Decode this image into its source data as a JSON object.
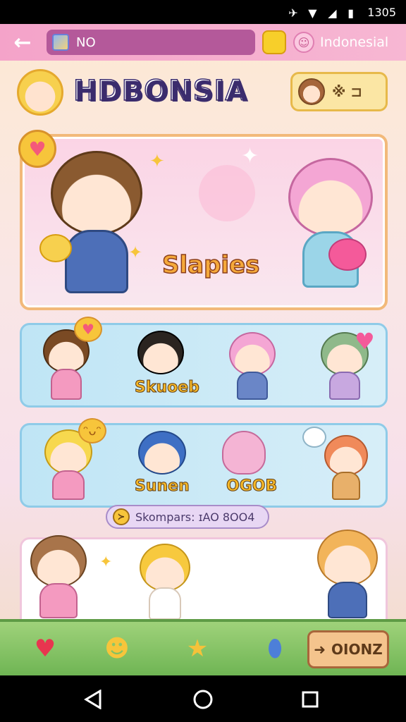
{
  "status": {
    "time": "1305"
  },
  "topbar": {
    "search_text": "NO",
    "language": "Indonesial"
  },
  "header": {
    "title": "HDBONSIA",
    "profile_text": "※ ⊐"
  },
  "hero": {
    "title": "Slapies"
  },
  "row1": {
    "label": "Skuoeb"
  },
  "row2": {
    "label_a": "Sunen",
    "label_b": "OGOB"
  },
  "tag": {
    "text": "Skompars: ɪAO 8OO4"
  },
  "bottom_bar": {
    "go_label": "OIONZ"
  },
  "colors": {
    "accent": "#f4a3c9",
    "hero_border": "#f2b97a",
    "row_bg": "#bfe5f5",
    "bottom_bar": "#9fd27a"
  }
}
